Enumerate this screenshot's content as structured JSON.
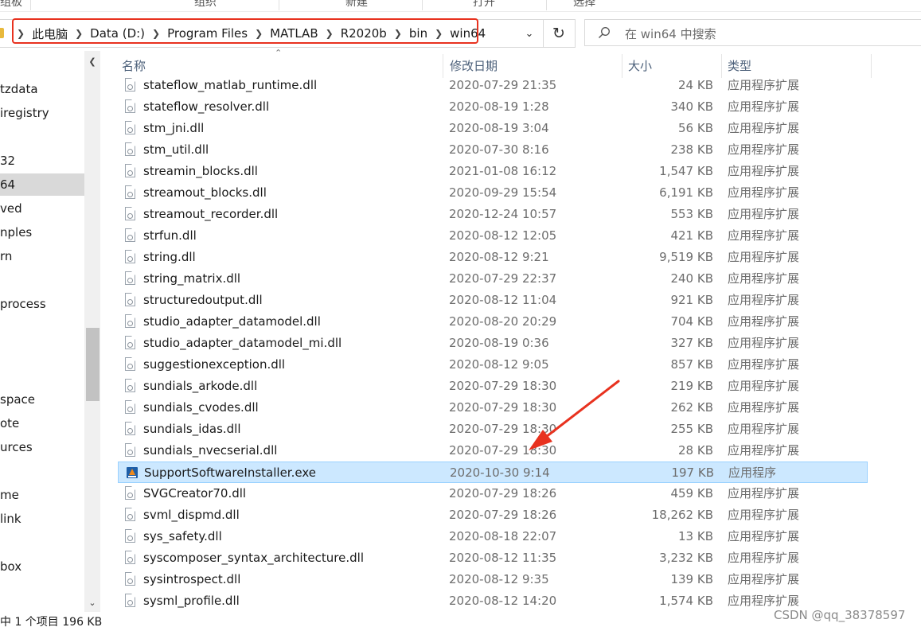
{
  "ribbon": {
    "groups": [
      "组板",
      "组织",
      "新建",
      "打开",
      "选择"
    ]
  },
  "address": {
    "crumbs": [
      "此电脑",
      "Data (D:)",
      "Program Files",
      "MATLAB",
      "R2020b",
      "bin",
      "win64"
    ]
  },
  "search": {
    "placeholder": "在 win64 中搜索"
  },
  "nav": {
    "items": [
      "tzdata",
      "iregistry",
      "",
      "32",
      "64",
      "ved",
      "nples",
      "rn",
      "",
      "process",
      "",
      "",
      "",
      "space",
      "ote",
      "urces",
      "",
      "me",
      "link",
      "",
      "box"
    ],
    "selected_index": 4
  },
  "columns": {
    "name": "名称",
    "date": "修改日期",
    "size": "大小",
    "type": "类型"
  },
  "files": [
    {
      "name": "stateflow_matlab_runtime.dll",
      "date": "2020-07-29 21:35",
      "size": "24 KB",
      "type": "应用程序扩展",
      "kind": "dll"
    },
    {
      "name": "stateflow_resolver.dll",
      "date": "2020-08-19 1:28",
      "size": "340 KB",
      "type": "应用程序扩展",
      "kind": "dll"
    },
    {
      "name": "stm_jni.dll",
      "date": "2020-08-19 3:04",
      "size": "56 KB",
      "type": "应用程序扩展",
      "kind": "dll"
    },
    {
      "name": "stm_util.dll",
      "date": "2020-07-30 8:16",
      "size": "238 KB",
      "type": "应用程序扩展",
      "kind": "dll"
    },
    {
      "name": "streamin_blocks.dll",
      "date": "2021-01-08 16:12",
      "size": "1,547 KB",
      "type": "应用程序扩展",
      "kind": "dll"
    },
    {
      "name": "streamout_blocks.dll",
      "date": "2020-09-29 15:54",
      "size": "6,191 KB",
      "type": "应用程序扩展",
      "kind": "dll"
    },
    {
      "name": "streamout_recorder.dll",
      "date": "2020-12-24 10:57",
      "size": "553 KB",
      "type": "应用程序扩展",
      "kind": "dll"
    },
    {
      "name": "strfun.dll",
      "date": "2020-08-12 12:05",
      "size": "421 KB",
      "type": "应用程序扩展",
      "kind": "dll"
    },
    {
      "name": "string.dll",
      "date": "2020-08-12 9:21",
      "size": "9,519 KB",
      "type": "应用程序扩展",
      "kind": "dll"
    },
    {
      "name": "string_matrix.dll",
      "date": "2020-07-29 22:37",
      "size": "240 KB",
      "type": "应用程序扩展",
      "kind": "dll"
    },
    {
      "name": "structuredoutput.dll",
      "date": "2020-08-12 11:04",
      "size": "921 KB",
      "type": "应用程序扩展",
      "kind": "dll"
    },
    {
      "name": "studio_adapter_datamodel.dll",
      "date": "2020-08-20 20:29",
      "size": "704 KB",
      "type": "应用程序扩展",
      "kind": "dll"
    },
    {
      "name": "studio_adapter_datamodel_mi.dll",
      "date": "2020-08-19 0:36",
      "size": "327 KB",
      "type": "应用程序扩展",
      "kind": "dll"
    },
    {
      "name": "suggestionexception.dll",
      "date": "2020-08-12 9:05",
      "size": "857 KB",
      "type": "应用程序扩展",
      "kind": "dll"
    },
    {
      "name": "sundials_arkode.dll",
      "date": "2020-07-29 18:30",
      "size": "219 KB",
      "type": "应用程序扩展",
      "kind": "dll"
    },
    {
      "name": "sundials_cvodes.dll",
      "date": "2020-07-29 18:30",
      "size": "262 KB",
      "type": "应用程序扩展",
      "kind": "dll"
    },
    {
      "name": "sundials_idas.dll",
      "date": "2020-07-29 18:30",
      "size": "255 KB",
      "type": "应用程序扩展",
      "kind": "dll"
    },
    {
      "name": "sundials_nvecserial.dll",
      "date": "2020-07-29 18:30",
      "size": "28 KB",
      "type": "应用程序扩展",
      "kind": "dll"
    },
    {
      "name": "SupportSoftwareInstaller.exe",
      "date": "2020-10-30 9:14",
      "size": "197 KB",
      "type": "应用程序",
      "kind": "exe",
      "selected": true
    },
    {
      "name": "SVGCreator70.dll",
      "date": "2020-07-29 18:26",
      "size": "459 KB",
      "type": "应用程序扩展",
      "kind": "dll"
    },
    {
      "name": "svml_dispmd.dll",
      "date": "2020-07-29 18:26",
      "size": "18,262 KB",
      "type": "应用程序扩展",
      "kind": "dll"
    },
    {
      "name": "sys_safety.dll",
      "date": "2020-08-18 22:07",
      "size": "13 KB",
      "type": "应用程序扩展",
      "kind": "dll"
    },
    {
      "name": "syscomposer_syntax_architecture.dll",
      "date": "2020-08-12 11:35",
      "size": "3,232 KB",
      "type": "应用程序扩展",
      "kind": "dll"
    },
    {
      "name": "sysintrospect.dll",
      "date": "2020-08-12 9:35",
      "size": "139 KB",
      "type": "应用程序扩展",
      "kind": "dll"
    },
    {
      "name": "sysml_profile.dll",
      "date": "2020-08-12 14:20",
      "size": "1,574 KB",
      "type": "应用程序扩展",
      "kind": "dll"
    }
  ],
  "status": {
    "text": "中 1 个项目  196 KB"
  },
  "watermark": "CSDN @qq_38378597",
  "colors": {
    "highlight_box": "#e8321f",
    "arrow": "#e8321f",
    "selection_bg": "#cce8ff",
    "selection_border": "#99d1ff"
  }
}
